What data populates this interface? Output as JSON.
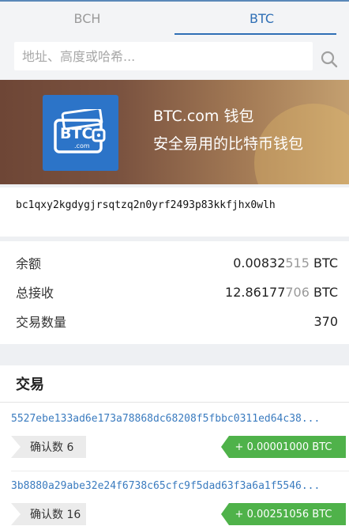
{
  "tabs": [
    {
      "label": "BCH",
      "active": false
    },
    {
      "label": "BTC",
      "active": true
    }
  ],
  "search": {
    "placeholder": "地址、高度或哈希..."
  },
  "banner": {
    "logo_text": "BTC",
    "logo_subtext": ".com",
    "line1": "BTC.com 钱包",
    "line2": "安全易用的比特币钱包"
  },
  "address": "bc1qxy2kgdygjrsqtzq2n0yrf2493p83kkfjhx0wlh",
  "stats": {
    "balance_label": "余额",
    "balance_main": "0.00832",
    "balance_dim": "515",
    "balance_unit": " BTC",
    "received_label": "总接收",
    "received_main": "12.86177",
    "received_dim": "706",
    "received_unit": " BTC",
    "tx_count_label": "交易数量",
    "tx_count": "370"
  },
  "transactions": {
    "title": "交易",
    "items": [
      {
        "hash": "5527ebe133ad6e173a78868dc68208f5fbbc0311ed64c38...",
        "confirmations": "确认数 6",
        "amount": "+ 0.00001000 BTC"
      },
      {
        "hash": "3b8880a29abe32e24f6738c65cfc9f5dad63f3a6a1f5546...",
        "confirmations": "确认数 16",
        "amount": "+ 0.00251056 BTC"
      }
    ]
  },
  "colors": {
    "accent": "#2f6fb5",
    "positive": "#4fb24a",
    "link": "#3a7bbf"
  }
}
